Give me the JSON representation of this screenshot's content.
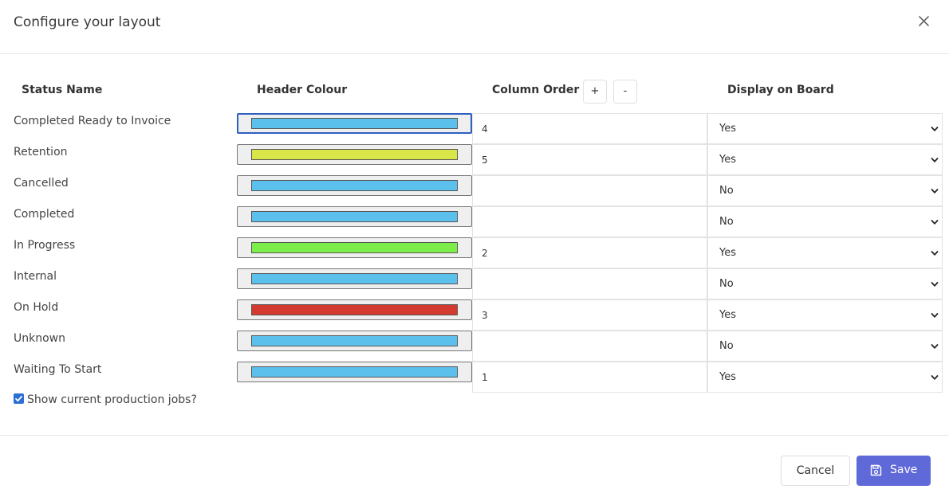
{
  "dialog": {
    "title": "Configure your layout",
    "close_icon": "close-icon"
  },
  "columns": {
    "status_name": "Status Name",
    "header_colour": "Header Colour",
    "column_order": "Column Order",
    "order_increase": "+",
    "order_decrease": "-",
    "display_on_board": "Display on Board"
  },
  "rows": [
    {
      "name": "Completed Ready to Invoice",
      "colour": "#5bc0eb",
      "order": "4",
      "display": "Yes"
    },
    {
      "name": "Retention",
      "colour": "#d9e64a",
      "order": "5",
      "display": "Yes"
    },
    {
      "name": "Cancelled",
      "colour": "#5bc0eb",
      "order": "",
      "display": "No"
    },
    {
      "name": "Completed",
      "colour": "#5bc0eb",
      "order": "",
      "display": "No"
    },
    {
      "name": "In Progress",
      "colour": "#7ded4a",
      "order": "2",
      "display": "Yes"
    },
    {
      "name": "Internal",
      "colour": "#5bc0eb",
      "order": "",
      "display": "No"
    },
    {
      "name": "On Hold",
      "colour": "#d43a2f",
      "order": "3",
      "display": "Yes"
    },
    {
      "name": "Unknown",
      "colour": "#5bc0eb",
      "order": "",
      "display": "No"
    },
    {
      "name": "Waiting To Start",
      "colour": "#5bc0eb",
      "order": "1",
      "display": "Yes"
    }
  ],
  "options": {
    "show_production_jobs_label": "Show current production jobs?",
    "show_production_jobs_checked": true
  },
  "footer": {
    "cancel_label": "Cancel",
    "save_label": "Save",
    "save_icon": "floppy-disk-icon"
  },
  "theme": {
    "primary": "#6069d8",
    "focus_border": "#2f5fbf"
  }
}
